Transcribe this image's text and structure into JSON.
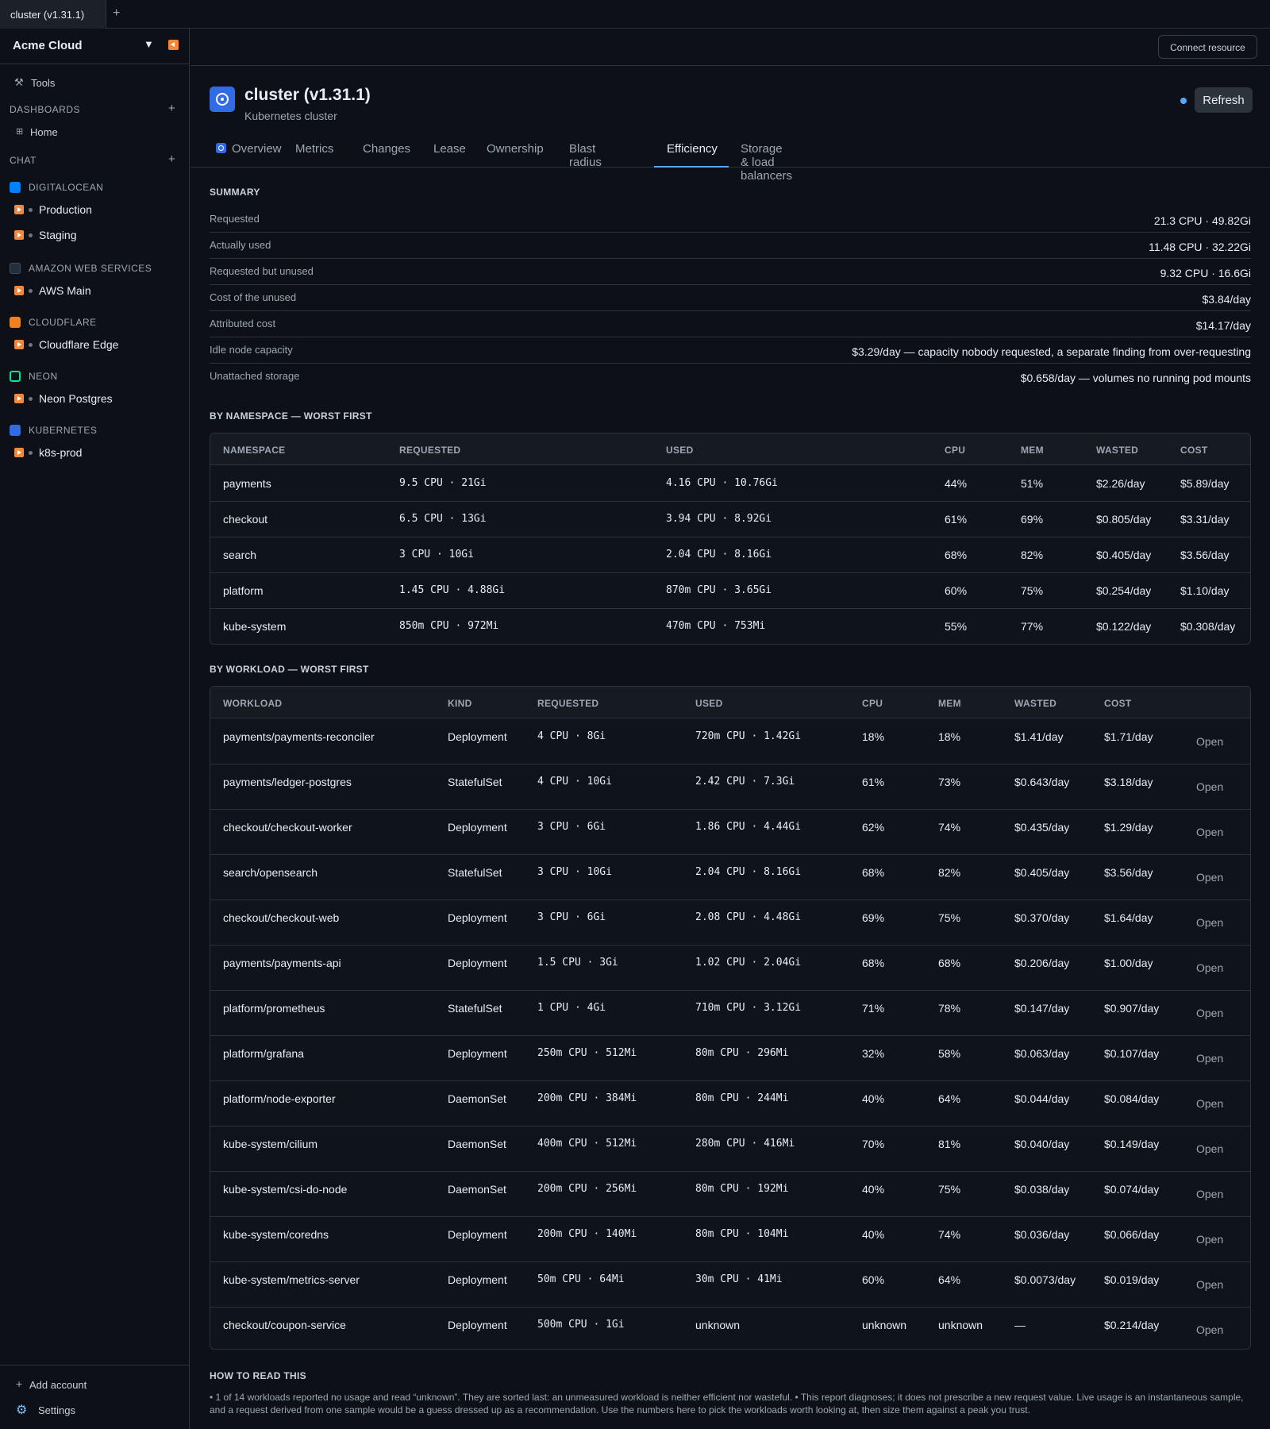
{
  "window_tab": {
    "label": "cluster (v1.31.1)",
    "add": "+"
  },
  "sidebar": {
    "org_name": "Acme Cloud",
    "tools": "Tools",
    "dashboards": {
      "title": "DASHBOARDS",
      "add": "+",
      "items": [
        {
          "label": "Home"
        }
      ]
    },
    "chat": {
      "title": "CHAT",
      "add": "+"
    },
    "providers": [
      {
        "name": "DIGITALOCEAN",
        "icon": "digitalocean-icon",
        "color": "#0080ff",
        "envs": [
          "Production",
          "Staging"
        ]
      },
      {
        "name": "AMAZON WEB SERVICES",
        "icon": "aws-icon",
        "color": "#232f3e",
        "envs": [
          "AWS Main"
        ]
      },
      {
        "name": "CLOUDFLARE",
        "icon": "cloudflare-icon",
        "color": "#f38020",
        "envs": [
          "Cloudflare Edge"
        ]
      },
      {
        "name": "NEON",
        "icon": "neon-icon",
        "color": "#00e599",
        "envs": [
          "Neon Postgres"
        ]
      },
      {
        "name": "KUBERNETES",
        "icon": "kubernetes-icon",
        "color": "#326ce5",
        "envs": [
          "k8s-prod"
        ]
      }
    ],
    "add_account": "Add account",
    "settings": "Settings"
  },
  "topbar": {
    "connect": "Connect resource"
  },
  "header": {
    "title": "cluster (v1.31.1)",
    "subtitle": "Kubernetes cluster",
    "refresh": "Refresh",
    "tabs": [
      "Overview",
      "Metrics",
      "Changes",
      "Lease",
      "Ownership",
      "Blast radius",
      "Efficiency",
      "Storage & load balancers"
    ],
    "active_tab": "Efficiency"
  },
  "summary": {
    "title": "SUMMARY",
    "rows": [
      {
        "label": "Requested",
        "value": "21.3 CPU · 49.82Gi"
      },
      {
        "label": "Actually used",
        "value": "11.48 CPU · 32.22Gi"
      },
      {
        "label": "Requested but unused",
        "value": "9.32 CPU · 16.6Gi"
      },
      {
        "label": "Cost of the unused",
        "value": "$3.84/day"
      },
      {
        "label": "Attributed cost",
        "value": "$14.17/day"
      },
      {
        "label": "Idle node capacity",
        "value": "$3.29/day — capacity nobody requested, a separate finding from over-requesting"
      },
      {
        "label": "Unattached storage",
        "value": "$0.658/day — volumes no running pod mounts"
      }
    ]
  },
  "namespaces": {
    "title": "BY NAMESPACE — WORST FIRST",
    "headers": [
      "NAMESPACE",
      "REQUESTED",
      "USED",
      "CPU",
      "MEM",
      "WASTED",
      "COST"
    ],
    "rows": [
      [
        "payments",
        "9.5 CPU · 21Gi",
        "4.16 CPU · 10.76Gi",
        "44%",
        "51%",
        "$2.26/day",
        "$5.89/day"
      ],
      [
        "checkout",
        "6.5 CPU · 13Gi",
        "3.94 CPU · 8.92Gi",
        "61%",
        "69%",
        "$0.805/day",
        "$3.31/day"
      ],
      [
        "search",
        "3 CPU · 10Gi",
        "2.04 CPU · 8.16Gi",
        "68%",
        "82%",
        "$0.405/day",
        "$3.56/day"
      ],
      [
        "platform",
        "1.45 CPU · 4.88Gi",
        "870m CPU · 3.65Gi",
        "60%",
        "75%",
        "$0.254/day",
        "$1.10/day"
      ],
      [
        "kube-system",
        "850m CPU · 972Mi",
        "470m CPU · 753Mi",
        "55%",
        "77%",
        "$0.122/day",
        "$0.308/day"
      ]
    ]
  },
  "workloads": {
    "title": "BY WORKLOAD — WORST FIRST",
    "headers": [
      "WORKLOAD",
      "KIND",
      "REQUESTED",
      "USED",
      "CPU",
      "MEM",
      "WASTED",
      "COST"
    ],
    "open_label": "Open",
    "rows": [
      [
        "payments/payments-reconciler",
        "Deployment",
        "4 CPU · 8Gi",
        "720m CPU · 1.42Gi",
        "18%",
        "18%",
        "$1.41/day",
        "$1.71/day"
      ],
      [
        "payments/ledger-postgres",
        "StatefulSet",
        "4 CPU · 10Gi",
        "2.42 CPU · 7.3Gi",
        "61%",
        "73%",
        "$0.643/day",
        "$3.18/day"
      ],
      [
        "checkout/checkout-worker",
        "Deployment",
        "3 CPU · 6Gi",
        "1.86 CPU · 4.44Gi",
        "62%",
        "74%",
        "$0.435/day",
        "$1.29/day"
      ],
      [
        "search/opensearch",
        "StatefulSet",
        "3 CPU · 10Gi",
        "2.04 CPU · 8.16Gi",
        "68%",
        "82%",
        "$0.405/day",
        "$3.56/day"
      ],
      [
        "checkout/checkout-web",
        "Deployment",
        "3 CPU · 6Gi",
        "2.08 CPU · 4.48Gi",
        "69%",
        "75%",
        "$0.370/day",
        "$1.64/day"
      ],
      [
        "payments/payments-api",
        "Deployment",
        "1.5 CPU · 3Gi",
        "1.02 CPU · 2.04Gi",
        "68%",
        "68%",
        "$0.206/day",
        "$1.00/day"
      ],
      [
        "platform/prometheus",
        "StatefulSet",
        "1 CPU · 4Gi",
        "710m CPU · 3.12Gi",
        "71%",
        "78%",
        "$0.147/day",
        "$0.907/day"
      ],
      [
        "platform/grafana",
        "Deployment",
        "250m CPU · 512Mi",
        "80m CPU · 296Mi",
        "32%",
        "58%",
        "$0.063/day",
        "$0.107/day"
      ],
      [
        "platform/node-exporter",
        "DaemonSet",
        "200m CPU · 384Mi",
        "80m CPU · 244Mi",
        "40%",
        "64%",
        "$0.044/day",
        "$0.084/day"
      ],
      [
        "kube-system/cilium",
        "DaemonSet",
        "400m CPU · 512Mi",
        "280m CPU · 416Mi",
        "70%",
        "81%",
        "$0.040/day",
        "$0.149/day"
      ],
      [
        "kube-system/csi-do-node",
        "DaemonSet",
        "200m CPU · 256Mi",
        "80m CPU · 192Mi",
        "40%",
        "75%",
        "$0.038/day",
        "$0.074/day"
      ],
      [
        "kube-system/coredns",
        "Deployment",
        "200m CPU · 140Mi",
        "80m CPU · 104Mi",
        "40%",
        "74%",
        "$0.036/day",
        "$0.066/day"
      ],
      [
        "kube-system/metrics-server",
        "Deployment",
        "50m CPU · 64Mi",
        "30m CPU · 41Mi",
        "60%",
        "64%",
        "$0.0073/day",
        "$0.019/day"
      ],
      [
        "checkout/coupon-service",
        "Deployment",
        "500m CPU · 1Gi",
        "unknown",
        "unknown",
        "unknown",
        "—",
        "$0.214/day"
      ]
    ]
  },
  "howto": {
    "title": "HOW TO READ THIS",
    "text": "• 1 of 14 workloads reported no usage and read “unknown”. They are sorted last: an unmeasured workload is neither efficient nor wasteful. • This report diagnoses; it does not prescribe a new request value. Live usage is an instantaneous sample, and a request derived from one sample would be a guess dressed up as a recommendation. Use the numbers here to pick the workloads worth looking at, then size them against a peak you trust."
  }
}
